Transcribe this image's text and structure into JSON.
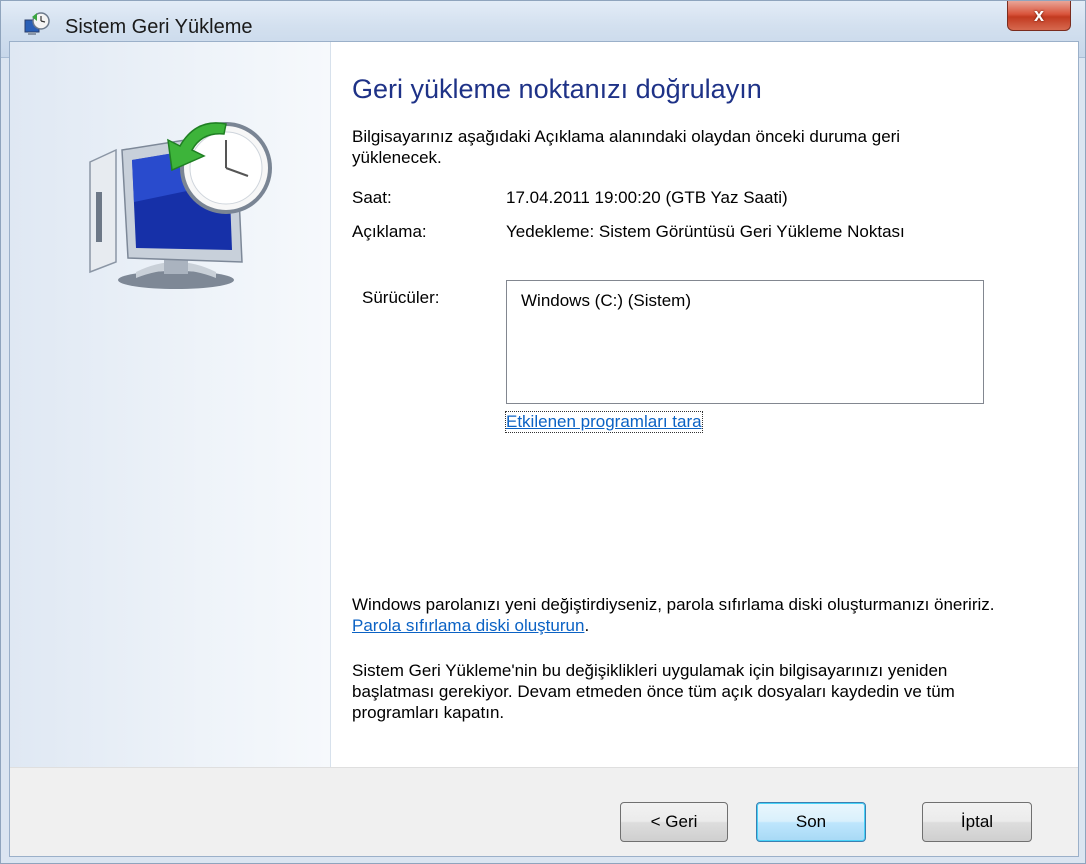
{
  "window": {
    "title": "Sistem Geri Yükleme",
    "close_label": "x"
  },
  "main": {
    "heading": "Geri yükleme noktanızı doğrulayın",
    "intro": "Bilgisayarınız aşağıdaki Açıklama alanındaki olaydan önceki duruma geri yüklenecek.",
    "time_label": "Saat:",
    "time_value": "17.04.2011 19:00:20 (GTB Yaz Saati)",
    "description_label": "Açıklama:",
    "description_value": "Yedekleme: Sistem Görüntüsü Geri Yükleme Noktası",
    "drives_label": "Sürücüler:",
    "drives": [
      "Windows (C:) (Sistem)"
    ],
    "scan_link": "Etkilenen programları tara",
    "password_note_prefix": "Windows parolanızı yeni değiştirdiyseniz, parola sıfırlama diski oluşturmanızı öneririz. ",
    "password_link": "Parola sıfırlama diski oluşturun",
    "password_note_suffix": ".",
    "restart_note": "Sistem Geri Yükleme'nin bu değişiklikleri uygulamak için bilgisayarınızı yeniden başlatması gerekiyor. Devam etmeden önce tüm açık dosyaları kaydedin ve tüm programları kapatın."
  },
  "buttons": {
    "back": "< Geri",
    "finish": "Son",
    "cancel": "İptal"
  },
  "icons": {
    "title": "system-restore-icon",
    "hero": "system-restore-clock-monitor-icon"
  }
}
